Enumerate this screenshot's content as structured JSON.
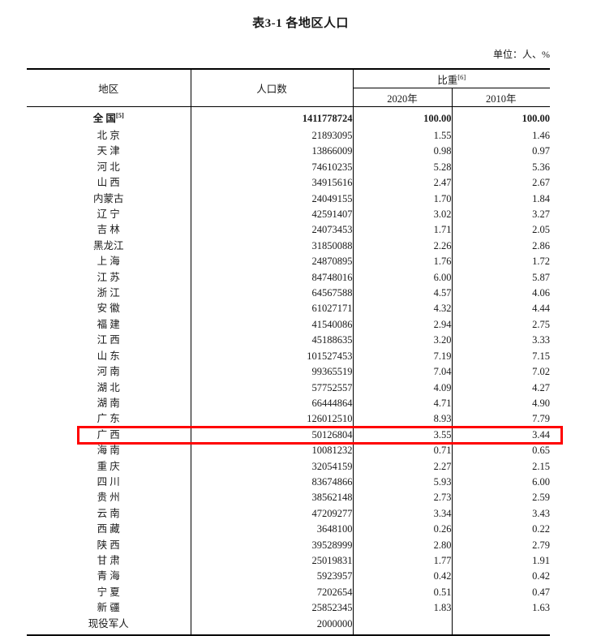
{
  "document": {
    "title": "表3-1 各地区人口",
    "unit_note": "单位：人、%"
  },
  "table": {
    "headers": {
      "region": "地区",
      "population": "人口数",
      "ratio": "比重",
      "ratio_footnote": "[6]",
      "year_2020": "2020年",
      "year_2010": "2010年"
    },
    "rows": [
      {
        "region": "全 国",
        "footnote": "[5]",
        "population": "1411778724",
        "p2020": "100.00",
        "p2010": "100.00",
        "bold": true
      },
      {
        "region": "北  京",
        "footnote": "",
        "population": "21893095",
        "p2020": "1.55",
        "p2010": "1.46"
      },
      {
        "region": "天  津",
        "footnote": "",
        "population": "13866009",
        "p2020": "0.98",
        "p2010": "0.97"
      },
      {
        "region": "河  北",
        "footnote": "",
        "population": "74610235",
        "p2020": "5.28",
        "p2010": "5.36"
      },
      {
        "region": "山  西",
        "footnote": "",
        "population": "34915616",
        "p2020": "2.47",
        "p2010": "2.67"
      },
      {
        "region": "内蒙古",
        "footnote": "",
        "population": "24049155",
        "p2020": "1.70",
        "p2010": "1.84"
      },
      {
        "region": "辽  宁",
        "footnote": "",
        "population": "42591407",
        "p2020": "3.02",
        "p2010": "3.27"
      },
      {
        "region": "吉  林",
        "footnote": "",
        "population": "24073453",
        "p2020": "1.71",
        "p2010": "2.05"
      },
      {
        "region": "黑龙江",
        "footnote": "",
        "population": "31850088",
        "p2020": "2.26",
        "p2010": "2.86"
      },
      {
        "region": "上  海",
        "footnote": "",
        "population": "24870895",
        "p2020": "1.76",
        "p2010": "1.72"
      },
      {
        "region": "江  苏",
        "footnote": "",
        "population": "84748016",
        "p2020": "6.00",
        "p2010": "5.87"
      },
      {
        "region": "浙  江",
        "footnote": "",
        "population": "64567588",
        "p2020": "4.57",
        "p2010": "4.06"
      },
      {
        "region": "安  徽",
        "footnote": "",
        "population": "61027171",
        "p2020": "4.32",
        "p2010": "4.44"
      },
      {
        "region": "福  建",
        "footnote": "",
        "population": "41540086",
        "p2020": "2.94",
        "p2010": "2.75"
      },
      {
        "region": "江  西",
        "footnote": "",
        "population": "45188635",
        "p2020": "3.20",
        "p2010": "3.33"
      },
      {
        "region": "山  东",
        "footnote": "",
        "population": "101527453",
        "p2020": "7.19",
        "p2010": "7.15"
      },
      {
        "region": "河  南",
        "footnote": "",
        "population": "99365519",
        "p2020": "7.04",
        "p2010": "7.02"
      },
      {
        "region": "湖  北",
        "footnote": "",
        "population": "57752557",
        "p2020": "4.09",
        "p2010": "4.27"
      },
      {
        "region": "湖  南",
        "footnote": "",
        "population": "66444864",
        "p2020": "4.71",
        "p2010": "4.90"
      },
      {
        "region": "广  东",
        "footnote": "",
        "population": "126012510",
        "p2020": "8.93",
        "p2010": "7.79"
      },
      {
        "region": "广  西",
        "footnote": "",
        "population": "50126804",
        "p2020": "3.55",
        "p2010": "3.44",
        "highlighted": true
      },
      {
        "region": "海  南",
        "footnote": "",
        "population": "10081232",
        "p2020": "0.71",
        "p2010": "0.65"
      },
      {
        "region": "重  庆",
        "footnote": "",
        "population": "32054159",
        "p2020": "2.27",
        "p2010": "2.15"
      },
      {
        "region": "四  川",
        "footnote": "",
        "population": "83674866",
        "p2020": "5.93",
        "p2010": "6.00"
      },
      {
        "region": "贵  州",
        "footnote": "",
        "population": "38562148",
        "p2020": "2.73",
        "p2010": "2.59"
      },
      {
        "region": "云  南",
        "footnote": "",
        "population": "47209277",
        "p2020": "3.34",
        "p2010": "3.43"
      },
      {
        "region": "西  藏",
        "footnote": "",
        "population": "3648100",
        "p2020": "0.26",
        "p2010": "0.22"
      },
      {
        "region": "陕  西",
        "footnote": "",
        "population": "39528999",
        "p2020": "2.80",
        "p2010": "2.79"
      },
      {
        "region": "甘  肃",
        "footnote": "",
        "population": "25019831",
        "p2020": "1.77",
        "p2010": "1.91"
      },
      {
        "region": "青  海",
        "footnote": "",
        "population": "5923957",
        "p2020": "0.42",
        "p2010": "0.42"
      },
      {
        "region": "宁  夏",
        "footnote": "",
        "population": "7202654",
        "p2020": "0.51",
        "p2010": "0.47"
      },
      {
        "region": "新  疆",
        "footnote": "",
        "population": "25852345",
        "p2020": "1.83",
        "p2010": "1.63"
      },
      {
        "region": "现役军人",
        "footnote": "",
        "population": "2000000",
        "p2020": "",
        "p2010": ""
      }
    ]
  },
  "annotation": {
    "highlight_color": "#ff0000",
    "highlight_region": "广  西"
  }
}
